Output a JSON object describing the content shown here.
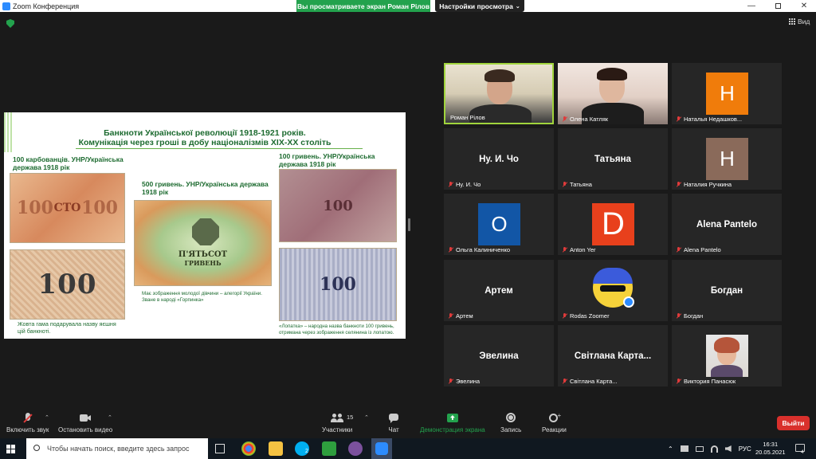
{
  "window": {
    "title": "Zoom Конференция",
    "share_banner": "Вы просматриваете экран Роман Рілов",
    "view_options": "Настройки просмотра",
    "view_label": "Вид",
    "chevron": "⌄"
  },
  "slide": {
    "title_line1": "Банкноти Української революції 1918-1921 років.",
    "title_line2": "Комунікація через гроші в добу націоналізмів ХІХ-ХХ століть",
    "caption_100k": "100 карбованців. УНР/Українська держава 1918 рік",
    "caption_500": "500 гривень. УНР/Українська держава 1918 рік",
    "caption_100g": "100 гривень. УНР/Українська держава 1918 рік",
    "note_100k": "Жовта гама подарувала назву яєшня цій банкноті.",
    "note_500": "Має зображення молодої дівчини – алегорії України. Зване в народі «Горпинка»",
    "note_100g": "«Лопатка» – народна назва банкноти 100 гривень, отримана через зображення селянина із лопатою.",
    "bill_texts": [
      "100",
      "СТО",
      "100",
      "П'ЯТЬСОТ",
      "ГРИВЕНЬ",
      "100",
      "100"
    ]
  },
  "participants": [
    {
      "name": "Роман Рілов",
      "type": "video",
      "active": true
    },
    {
      "name": "Олена Катляк",
      "type": "video",
      "muted": true
    },
    {
      "name": "Наталья Недашков...",
      "type": "letter",
      "letter": "H",
      "color": "#f07c0b",
      "muted": true
    },
    {
      "name": "Ну. И. Чо",
      "type": "text",
      "muted": true
    },
    {
      "name": "Татьяна",
      "type": "text",
      "muted": true
    },
    {
      "name": "Наталия Ручкина",
      "type": "letter",
      "letter": "H",
      "color": "#8a6a5a",
      "muted": true
    },
    {
      "name": "Ольга Калиниченко",
      "type": "letter",
      "letter": "O",
      "color": "#1256a6",
      "muted": true
    },
    {
      "name": "Anton Yer",
      "type": "letter",
      "letter": "D",
      "color": "#e8401c",
      "muted": true
    },
    {
      "name": "Alena Pantelo",
      "type": "text",
      "muted": true
    },
    {
      "name": "Артем",
      "type": "text",
      "muted": true
    },
    {
      "name": "Rodas Zoomer",
      "type": "emoji",
      "muted": true
    },
    {
      "name": "Богдан",
      "type": "text",
      "muted": true
    },
    {
      "name": "Эвелина",
      "type": "text",
      "muted": true
    },
    {
      "name": "Світлана Карта...",
      "type": "text",
      "muted": true
    },
    {
      "name": "Виктория Панасюк",
      "type": "photo",
      "muted": true
    }
  ],
  "toolbar": {
    "mic_label": "Включить звук",
    "video_label": "Остановить видео",
    "participants_label": "Участники",
    "participants_count": "15",
    "chat_label": "Чат",
    "share_label": "Демонстрация экрана",
    "record_label": "Запись",
    "reactions_label": "Реакции",
    "exit_label": "Выйти"
  },
  "taskbar": {
    "search_placeholder": "Чтобы начать поиск, введите здесь запрос",
    "language": "РУС",
    "time": "16:31",
    "date": "20.05.2021",
    "skype_badge": "2",
    "notif_count": "4"
  },
  "colors": {
    "accent_green": "#23a24d",
    "active_border": "#a0d43c",
    "exit_red": "#d9302c"
  }
}
